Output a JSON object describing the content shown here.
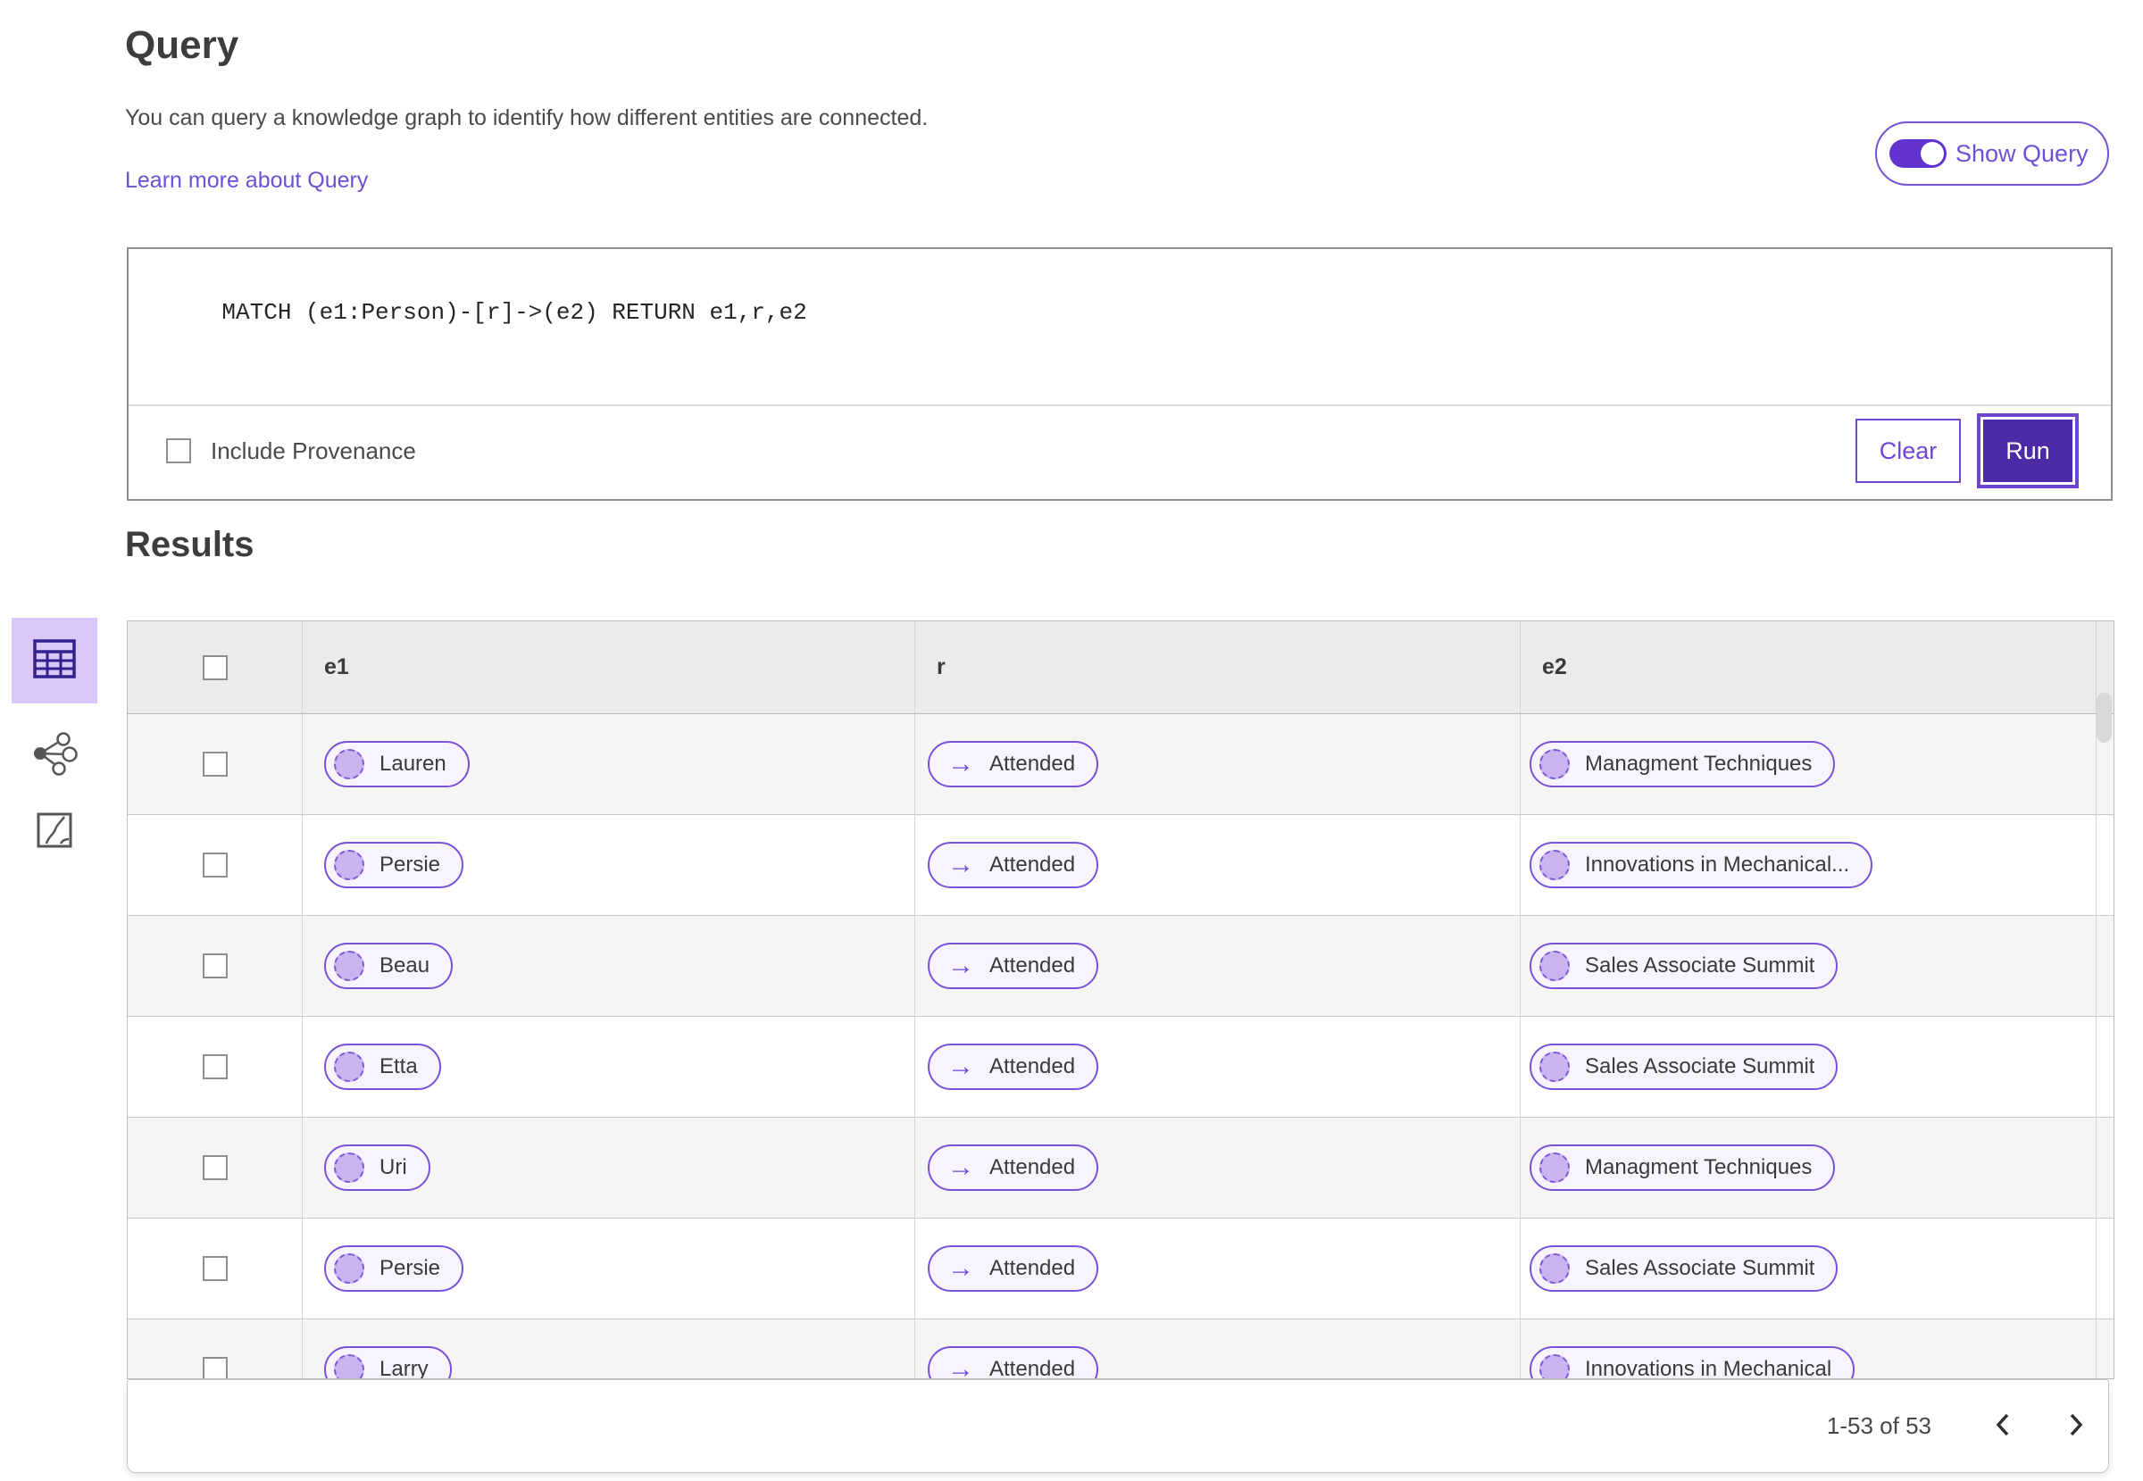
{
  "header": {
    "title": "Query",
    "description": "You can query a knowledge graph to identify how different entities are connected.",
    "learn_more_label": "Learn more about Query"
  },
  "show_query_toggle": {
    "label": "Show Query",
    "state": "on"
  },
  "query_editor": {
    "code": "MATCH (e1:Person)-[r]->(e2) RETURN e1,r,e2"
  },
  "provenance": {
    "label": "Include Provenance",
    "checked": false
  },
  "actions": {
    "clear_label": "Clear",
    "run_label": "Run"
  },
  "results": {
    "heading": "Results"
  },
  "view_switcher": {
    "items": [
      {
        "name": "table-view",
        "selected": true
      },
      {
        "name": "graph-view",
        "selected": false
      },
      {
        "name": "chart-view",
        "selected": false
      }
    ]
  },
  "table": {
    "columns": [
      "e1",
      "r",
      "e2"
    ],
    "relation_arrow": "→",
    "rows": [
      {
        "e1": "Lauren",
        "r": "Attended",
        "e2": "Managment Techniques"
      },
      {
        "e1": "Persie",
        "r": "Attended",
        "e2": "Innovations in Mechanical..."
      },
      {
        "e1": "Beau",
        "r": "Attended",
        "e2": "Sales Associate Summit"
      },
      {
        "e1": "Etta",
        "r": "Attended",
        "e2": "Sales Associate Summit"
      },
      {
        "e1": "Uri",
        "r": "Attended",
        "e2": "Managment Techniques"
      },
      {
        "e1": "Persie",
        "r": "Attended",
        "e2": "Sales Associate Summit"
      },
      {
        "e1": "Larry",
        "r": "Attended",
        "e2": "Innovations in Mechanical"
      }
    ]
  },
  "pagination": {
    "range_label": "1-53 of 53"
  },
  "colors": {
    "accent_purple": "#7552d6",
    "deep_purple": "#4e2ba6",
    "toggle_purple": "#6233cf",
    "link_purple": "#6e50d5",
    "selected_tab_bg": "#d9c8f7",
    "pill_bg": "#f7f4fd",
    "node_fill": "#cab4f0",
    "table_header_bg": "#ebebeb",
    "row_alt_bg": "#f5f5f5"
  }
}
